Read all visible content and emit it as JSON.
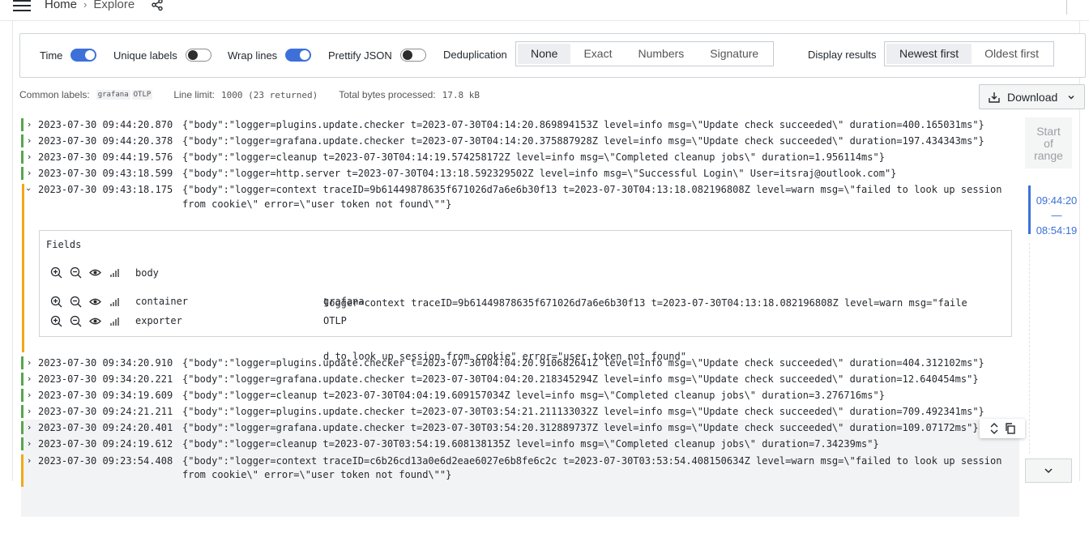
{
  "header": {
    "breadcrumb": [
      "Home",
      "Explore"
    ],
    "breadcrumb_sep": "›"
  },
  "options": {
    "time_label": "Time",
    "time_on": true,
    "unique_labels_label": "Unique labels",
    "unique_labels_on": false,
    "wrap_lines_label": "Wrap lines",
    "wrap_lines_on": true,
    "prettify_json_label": "Prettify JSON",
    "prettify_json_on": false,
    "dedup_label": "Deduplication",
    "dedup_options": [
      "None",
      "Exact",
      "Numbers",
      "Signature"
    ],
    "dedup_selected": "None",
    "display_results_label": "Display results",
    "display_options": [
      "Newest first",
      "Oldest first"
    ],
    "display_selected": "Newest first"
  },
  "meta": {
    "common_labels_label": "Common labels:",
    "common_labels": [
      "grafana",
      "OTLP"
    ],
    "line_limit_label": "Line limit:",
    "line_limit_value": "1000 (23 returned)",
    "bytes_label": "Total bytes processed:",
    "bytes_value": "17.8 kB"
  },
  "download_label": "Download",
  "logs": [
    {
      "ts": "2023-07-30 09:44:20.870",
      "msg": "{\"body\":\"logger=plugins.update.checker t=2023-07-30T04:14:20.869894153Z level=info msg=\\\"Update check succeeded\\\" duration=400.165031ms\"}",
      "level": "info"
    },
    {
      "ts": "2023-07-30 09:44:20.378",
      "msg": "{\"body\":\"logger=grafana.update.checker t=2023-07-30T04:14:20.375887928Z level=info msg=\\\"Update check succeeded\\\" duration=197.434343ms\"}",
      "level": "info"
    },
    {
      "ts": "2023-07-30 09:44:19.576",
      "msg": "{\"body\":\"logger=cleanup t=2023-07-30T04:14:19.574258172Z level=info msg=\\\"Completed cleanup jobs\\\" duration=1.956114ms\"}",
      "level": "info"
    },
    {
      "ts": "2023-07-30 09:43:18.599",
      "msg": "{\"body\":\"logger=http.server t=2023-07-30T04:13:18.592329502Z level=info msg=\\\"Successful Login\\\" User=itsraj@outlook.com\"}",
      "level": "info"
    },
    {
      "ts": "2023-07-30 09:43:18.175",
      "msg": "{\"body\":\"logger=context traceID=9b61449878635f671026d7a6e6b30f13 t=2023-07-30T04:13:18.082196808Z level=warn msg=\\\"failed to look up session",
      "msg2": "from cookie\\\" error=\\\"user token not found\\\"\"}",
      "level": "warn"
    },
    {
      "ts": "2023-07-30 09:34:20.910",
      "msg": "{\"body\":\"logger=plugins.update.checker t=2023-07-30T04:04:20.910682641Z level=info msg=\\\"Update check succeeded\\\" duration=404.312102ms\"}",
      "level": "info"
    },
    {
      "ts": "2023-07-30 09:34:20.221",
      "msg": "{\"body\":\"logger=grafana.update.checker t=2023-07-30T04:04:20.218345294Z level=info msg=\\\"Update check succeeded\\\" duration=12.640454ms\"}",
      "level": "info"
    },
    {
      "ts": "2023-07-30 09:34:19.609",
      "msg": "{\"body\":\"logger=cleanup t=2023-07-30T04:04:19.609157034Z level=info msg=\\\"Completed cleanup jobs\\\" duration=3.276716ms\"}",
      "level": "info"
    },
    {
      "ts": "2023-07-30 09:24:21.211",
      "msg": "{\"body\":\"logger=plugins.update.checker t=2023-07-30T03:54:21.211133032Z level=info msg=\\\"Update check succeeded\\\" duration=709.492341ms\"}",
      "level": "info"
    },
    {
      "ts": "2023-07-30 09:24:20.401",
      "msg": "{\"body\":\"logger=grafana.update.checker t=2023-07-30T03:54:20.312889737Z level=info msg=\\\"Update check succeeded\\\" duration=109.07172ms\"}",
      "level": "info"
    },
    {
      "ts": "2023-07-30 09:24:19.612",
      "msg": "{\"body\":\"logger=cleanup t=2023-07-30T03:54:19.608138135Z level=info msg=\\\"Completed cleanup jobs\\\" duration=7.34239ms\"}",
      "level": "info"
    },
    {
      "ts": "2023-07-30 09:23:54.408",
      "msg": "{\"body\":\"logger=context traceID=c6b26cd13a0e6d2eae6027e6b8fe6c2c t=2023-07-30T03:53:54.408150634Z level=warn msg=\\\"failed to look up session",
      "msg2": "from cookie\\\" error=\\\"user token not found\\\"\"}",
      "level": "warn"
    }
  ],
  "fields": {
    "title": "Fields",
    "rows": [
      {
        "key": "body",
        "value_line1": "logger=context traceID=9b61449878635f671026d7a6e6b30f13 t=2023-07-30T04:13:18.082196808Z level=warn msg=\"faile",
        "value_line2": "d to look up session from cookie\" error=\"user token not found\""
      },
      {
        "key": "container",
        "value_line1": "grafana"
      },
      {
        "key": "exporter",
        "value_line1": "OTLP"
      }
    ]
  },
  "range": {
    "start_label": "Start of range",
    "start_line1": "Start",
    "start_line2": "of",
    "start_line3": "range",
    "top_time": "09:44:20",
    "dash": "—",
    "bottom_time": "08:54:19"
  },
  "colors": {
    "info": "#56a64b",
    "warn": "#f2a818",
    "accent": "#3d71d9"
  },
  "icons": [
    "menu-icon",
    "share-icon",
    "download-icon",
    "chevron-down-icon",
    "chevron-right-icon",
    "zoom-in-icon",
    "zoom-out-icon",
    "eye-icon",
    "stats-icon",
    "expand-icon",
    "copy-icon"
  ]
}
